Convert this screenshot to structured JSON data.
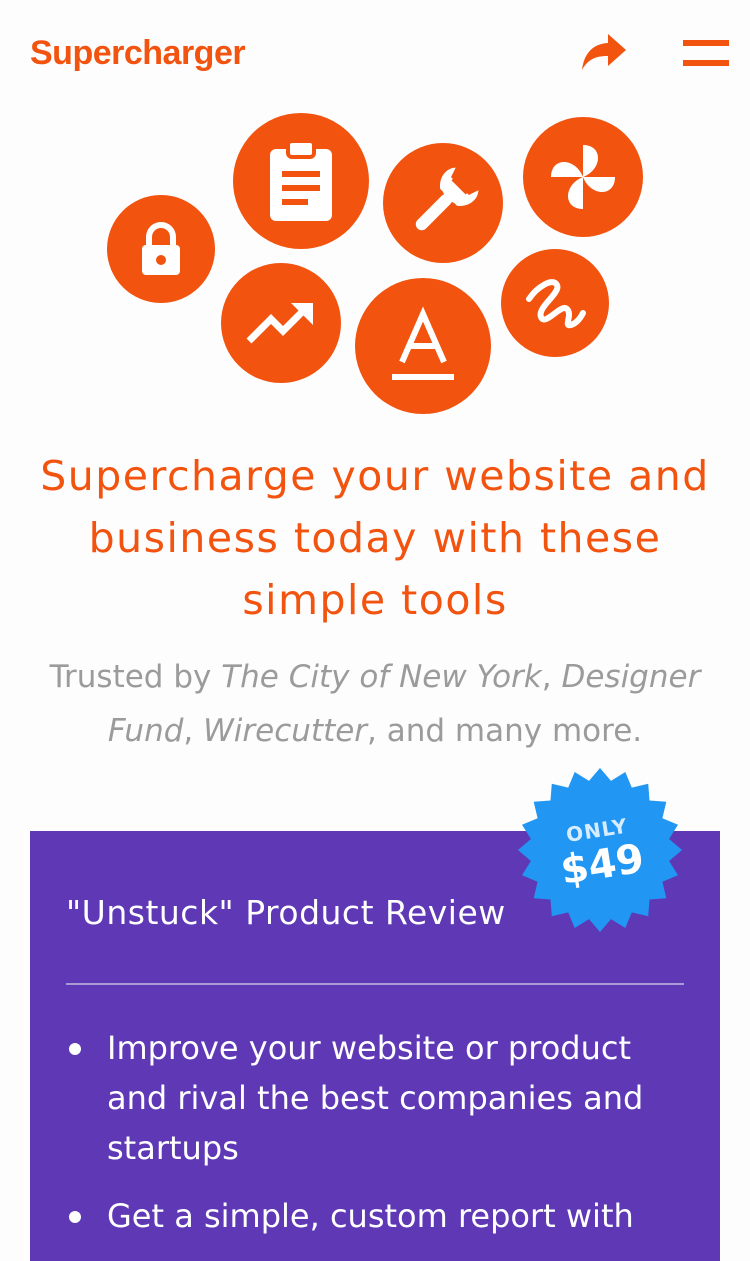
{
  "header": {
    "brand": "Supercharger",
    "share_icon": "share-arrow-icon",
    "menu_icon": "hamburger-menu-icon"
  },
  "hero_icons": [
    {
      "name": "lock-icon"
    },
    {
      "name": "clipboard-icon"
    },
    {
      "name": "wrench-icon"
    },
    {
      "name": "pinwheel-icon"
    },
    {
      "name": "trending-up-icon"
    },
    {
      "name": "text-format-icon",
      "glyph": "A"
    },
    {
      "name": "squiggle-icon"
    }
  ],
  "headline": "Supercharge your website and business today with these simple tools",
  "trusted": {
    "prefix": "Trusted by ",
    "client1": "The City of New York",
    "sep1": ", ",
    "client2": "Designer Fund",
    "sep2": ", ",
    "client3": "Wirecutter",
    "suffix": ", and many more."
  },
  "product_card": {
    "title": "\"Unstuck\" Product Review",
    "bullets": [
      "Improve your website or product and rival the best companies and startups",
      "Get a simple, custom report with"
    ]
  },
  "price_badge": {
    "label": "ONLY",
    "price": "$49"
  },
  "colors": {
    "accent": "#f2530f",
    "card_bg": "#5f38b6",
    "badge": "#2196f3",
    "muted_text": "#9b9b9b"
  }
}
